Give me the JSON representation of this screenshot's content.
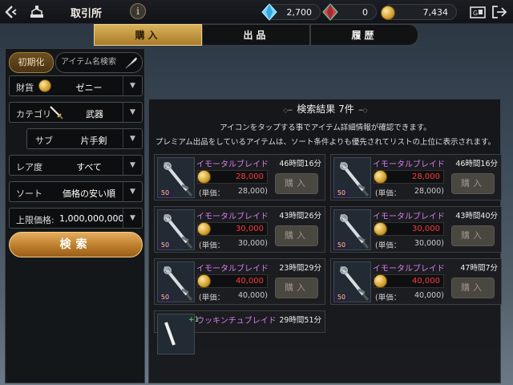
{
  "header": {
    "title": "取引所",
    "info_label": "i",
    "currencies": [
      {
        "icon": "blue-crystal-icon",
        "value": "2,700"
      },
      {
        "icon": "red-crystal-icon",
        "value": "0"
      },
      {
        "icon": "gold-coin-icon",
        "value": "7,434"
      }
    ]
  },
  "tabs": [
    {
      "label": "購入",
      "active": true
    },
    {
      "label": "出品",
      "active": false
    },
    {
      "label": "履歴",
      "active": false
    }
  ],
  "filters": {
    "reset_label": "初期化",
    "name_search_placeholder": "アイテム名検索",
    "currency_label": "財貨",
    "currency_value": "ゼニー",
    "category_label": "カテゴリ",
    "category_value": "武器",
    "sub_label": "サブ",
    "sub_value": "片手剣",
    "rarity_label": "レア度",
    "rarity_value": "すべて",
    "sort_label": "ソート",
    "sort_value": "価格の安い順",
    "max_price_label": "上限価格:",
    "max_price_value": "1,000,000,000",
    "search_label": "検索"
  },
  "results": {
    "title": "検索結果 7件",
    "hint1": "アイコンをタップする事でアイテム詳細情報が確認できます。",
    "hint2": "プレミアム出品をしているアイテムは、ソート条件よりも優先されてリストの上位に表示されます。",
    "unit_price_label": "(単価：",
    "buy_label": "購入",
    "items": [
      {
        "name": "イモータルブレイド",
        "time": "46時間16分",
        "price": "28,000",
        "unit_price": "28,000",
        "level": "50"
      },
      {
        "name": "イモータルブレイド",
        "time": "46時間16分",
        "price": "28,000",
        "unit_price": "28,000",
        "level": "50"
      },
      {
        "name": "イモータルブレイド",
        "time": "43時間26分",
        "price": "30,000",
        "unit_price": "30,000",
        "level": "50"
      },
      {
        "name": "イモータルブレイド",
        "time": "43時間40分",
        "price": "30,000",
        "unit_price": "30,000",
        "level": "50"
      },
      {
        "name": "イモータルブレイド",
        "time": "23時間29分",
        "price": "40,000",
        "unit_price": "40,000",
        "level": "50"
      },
      {
        "name": "イモータルブレイド",
        "time": "47時間7分",
        "price": "40,000",
        "unit_price": "40,000",
        "level": "50"
      },
      {
        "name": "ウッキンチュブレイド",
        "time": "29時間51分",
        "enhance": "+1"
      }
    ]
  }
}
